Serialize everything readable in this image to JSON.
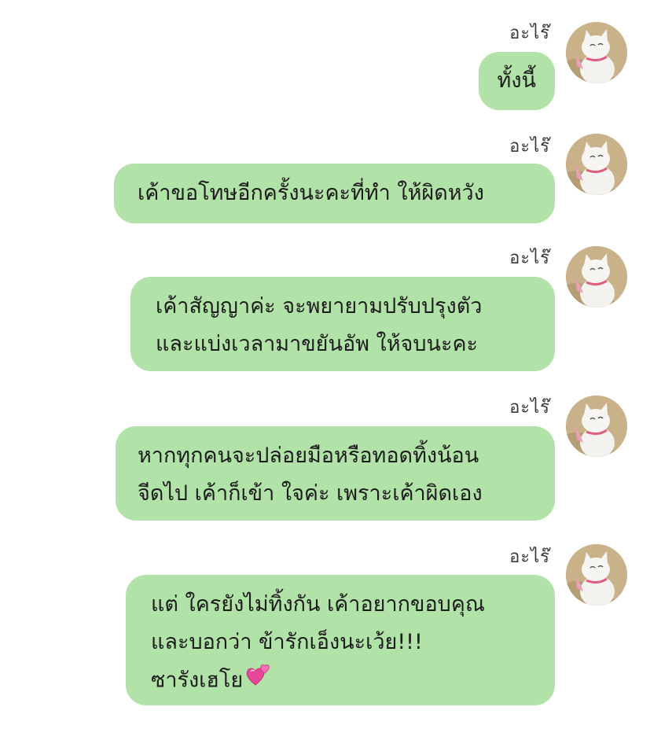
{
  "conversation": {
    "messages": [
      {
        "sender": "อะไร๊",
        "avatar_icon": "white-cat-avatar-icon",
        "lines": [
          "ทั้งนี้"
        ]
      },
      {
        "sender": "อะไร๊",
        "avatar_icon": "white-cat-avatar-icon",
        "lines": [
          "เค้าขอโทษอีกครั้งนะคะที่ทำ ให้ผิดหวัง"
        ]
      },
      {
        "sender": "อะไร๊",
        "avatar_icon": "white-cat-avatar-icon",
        "lines": [
          "เค้าสัญญาค่ะ จะพยายามปรับปรุงตัว",
          "และแบ่งเวลามาขยันอัพ ให้จบนะคะ"
        ]
      },
      {
        "sender": "อะไร๊",
        "avatar_icon": "white-cat-avatar-icon",
        "lines": [
          "หากทุกคนจะปล่อยมือหรือทอดทิ้งน้อน",
          "จีดไป เค้าก็เข้า ใจค่ะ เพราะเค้าผิดเอง"
        ]
      },
      {
        "sender": "อะไร๊",
        "avatar_icon": "white-cat-avatar-icon",
        "lines": [
          "แต่ ใครยังไม่ทิ้งกัน เค้าอยากขอบคุณ",
          "และบอกว่า ข้ารักเอ็งนะเว้ย!!!",
          "ซารังเฮโย"
        ],
        "trailing_icon": "two-hearts-icon"
      }
    ]
  },
  "colors": {
    "bubble": "#b1e2a8",
    "heart": "#e8489a"
  }
}
